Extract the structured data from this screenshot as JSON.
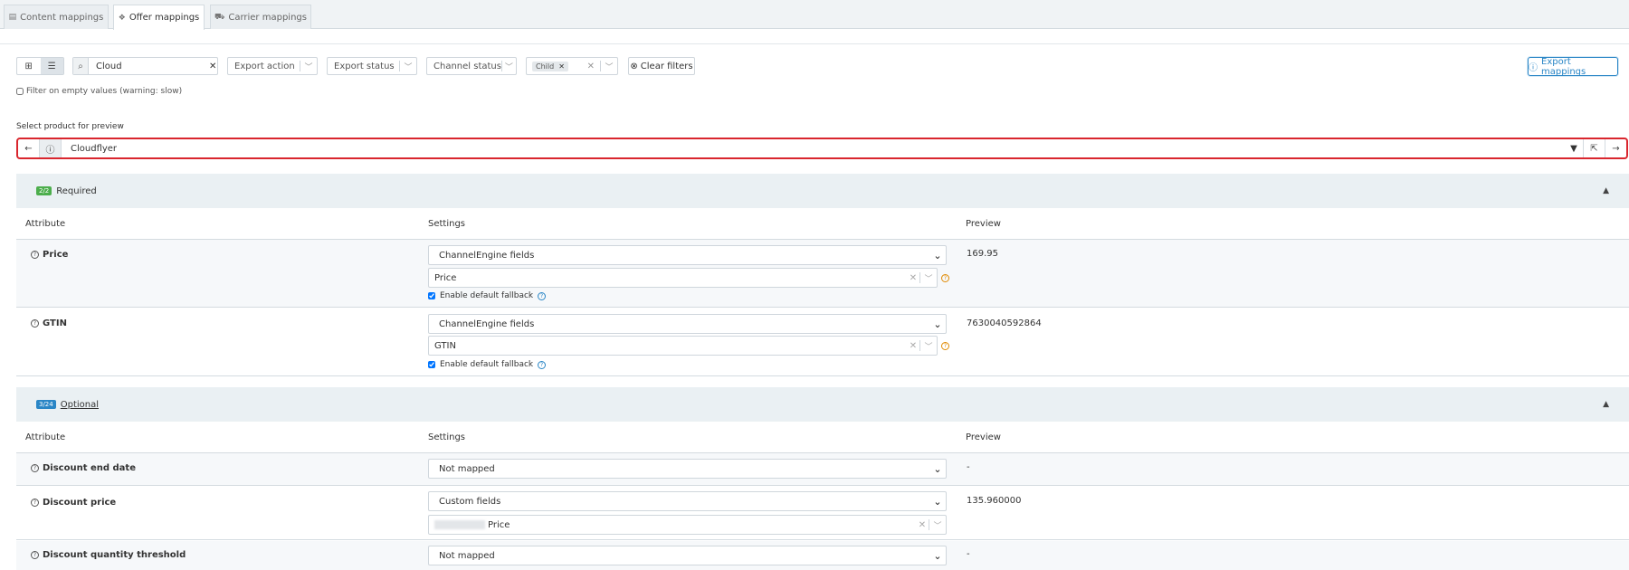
{
  "tabs": [
    {
      "label": "Content mappings",
      "icon": "grid-icon"
    },
    {
      "label": "Offer mappings",
      "icon": "tag-icon"
    },
    {
      "label": "Carrier mappings",
      "icon": "truck-icon"
    }
  ],
  "toolbar": {
    "search_value": "Cloud",
    "export_action": "Export action",
    "export_status": "Export status",
    "channel_status": "Channel status",
    "chip_label": "Child",
    "clear_filters": "Clear filters",
    "export_mappings": "Export mappings",
    "filter_empty": "Filter on empty values (warning: slow)"
  },
  "product_select": {
    "label": "Select product for preview",
    "value": "Cloudflyer"
  },
  "columns": {
    "attribute": "Attribute",
    "settings": "Settings",
    "preview": "Preview"
  },
  "required": {
    "badge": "2/2",
    "title": "Required",
    "rows": [
      {
        "name": "Price",
        "source": "ChannelEngine fields",
        "field": "Price",
        "fallback": "Enable default fallback",
        "preview": "169.95"
      },
      {
        "name": "GTIN",
        "source": "ChannelEngine fields",
        "field": "GTIN",
        "fallback": "Enable default fallback",
        "preview": "7630040592864"
      }
    ]
  },
  "optional": {
    "badge": "3/24",
    "title": "Optional",
    "rows": [
      {
        "name": "Discount end date",
        "source": "Not mapped",
        "preview": "-"
      },
      {
        "name": "Discount price",
        "source": "Custom fields",
        "field": "Price",
        "preview": "135.960000"
      },
      {
        "name": "Discount quantity threshold",
        "source": "Not mapped",
        "preview": "-"
      }
    ]
  },
  "colors": {
    "accent": "#2a86c6",
    "highlight": "#d9262e",
    "success": "#4cae4c",
    "warning": "#e08a00"
  }
}
